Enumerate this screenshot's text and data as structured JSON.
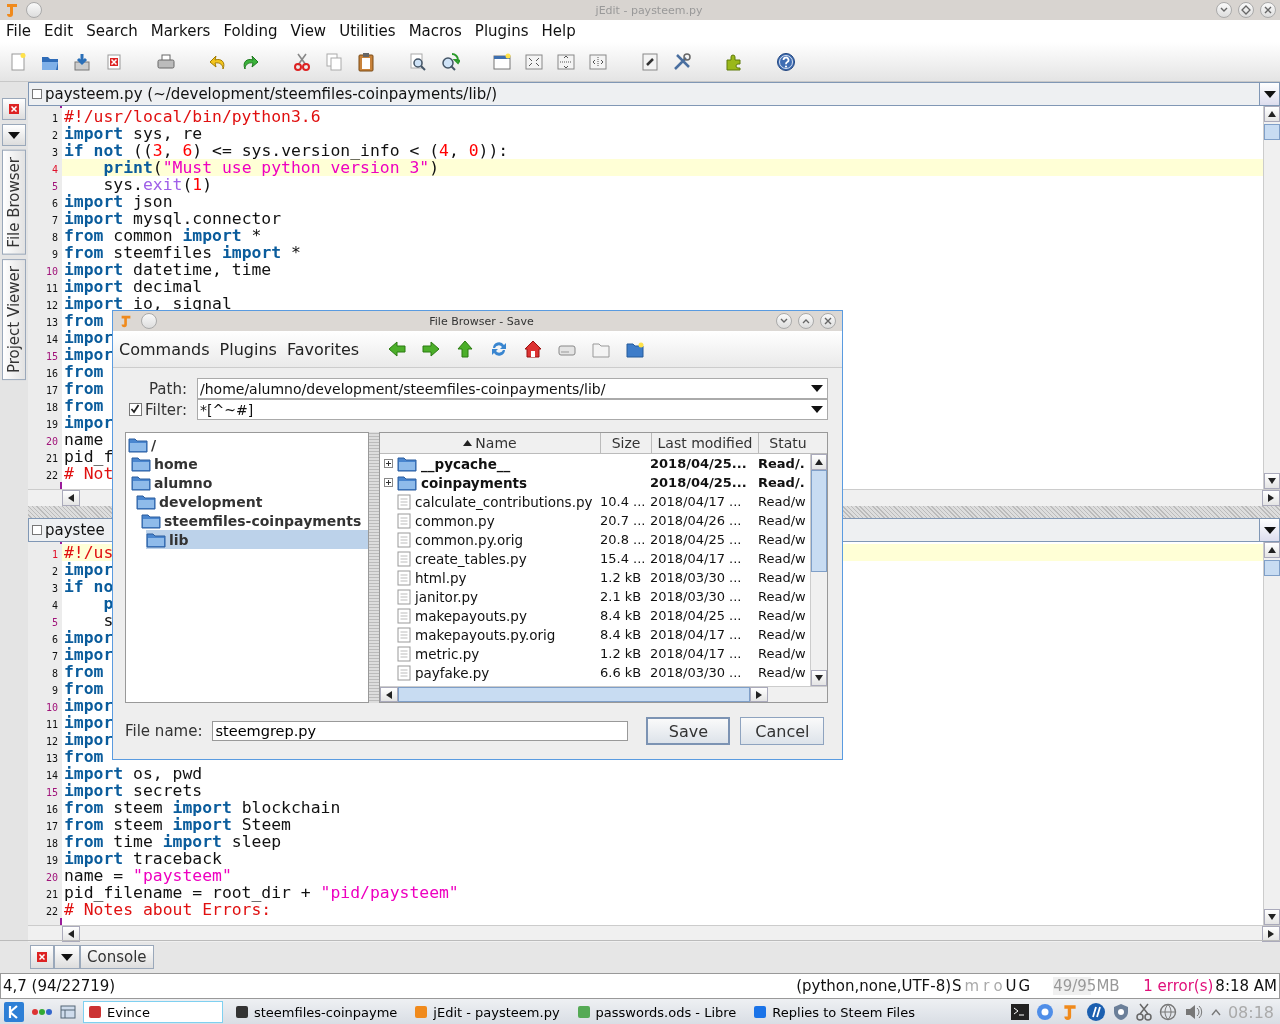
{
  "window": {
    "title": "jEdit - paysteem.py"
  },
  "menu": [
    "File",
    "Edit",
    "Search",
    "Markers",
    "Folding",
    "View",
    "Utilities",
    "Macros",
    "Plugins",
    "Help"
  ],
  "dock_tabs": [
    {
      "label": "File Browser",
      "selected": false
    },
    {
      "label": "Project Viewer",
      "selected": false
    }
  ],
  "panes": [
    {
      "title": "paysteem.py (~/development/steemfiles-coinpayments/lib/)",
      "lines": [
        {
          "number": "1",
          "current": false,
          "tokens": [
            {
              "kind": "comment",
              "text": "#!/usr/local/bin/python3.6"
            }
          ]
        },
        {
          "number": "2",
          "current": false,
          "tokens": [
            {
              "kind": "kw",
              "text": "import"
            },
            {
              "kind": "plain",
              "text": " sys, re"
            }
          ]
        },
        {
          "number": "3",
          "current": false,
          "tokens": [
            {
              "kind": "kw",
              "text": "if "
            },
            {
              "kind": "kw",
              "text": "not"
            },
            {
              "kind": "plain",
              "text": " (("
            },
            {
              "kind": "num",
              "text": "3"
            },
            {
              "kind": "plain",
              "text": ", "
            },
            {
              "kind": "num",
              "text": "6"
            },
            {
              "kind": "plain",
              "text": ") <= sys.version_info < ("
            },
            {
              "kind": "num",
              "text": "4"
            },
            {
              "kind": "plain",
              "text": ", "
            },
            {
              "kind": "num",
              "text": "0"
            },
            {
              "kind": "plain",
              "text": ")):"
            }
          ]
        },
        {
          "number": "4",
          "current": true,
          "tokens": [
            {
              "kind": "kw",
              "text": "    print"
            },
            {
              "kind": "plain",
              "text": "("
            },
            {
              "kind": "str",
              "text": "\"Must use python version 3\""
            },
            {
              "kind": "plain",
              "text": ")"
            }
          ]
        },
        {
          "number": "5",
          "current": false,
          "tokens": [
            {
              "kind": "plain",
              "text": "    sys."
            },
            {
              "kind": "fn",
              "text": "exit"
            },
            {
              "kind": "plain",
              "text": "("
            },
            {
              "kind": "num",
              "text": "1"
            },
            {
              "kind": "plain",
              "text": ")"
            }
          ]
        },
        {
          "number": "6",
          "current": false,
          "tokens": [
            {
              "kind": "kw",
              "text": "import"
            },
            {
              "kind": "plain",
              "text": " json"
            }
          ]
        },
        {
          "number": "7",
          "current": false,
          "tokens": [
            {
              "kind": "kw",
              "text": "import"
            },
            {
              "kind": "plain",
              "text": " mysql.connector"
            }
          ]
        },
        {
          "number": "8",
          "current": false,
          "tokens": [
            {
              "kind": "kw",
              "text": "from"
            },
            {
              "kind": "plain",
              "text": " common "
            },
            {
              "kind": "kw",
              "text": "import"
            },
            {
              "kind": "plain",
              "text": " *"
            }
          ]
        },
        {
          "number": "9",
          "current": false,
          "tokens": [
            {
              "kind": "kw",
              "text": "from"
            },
            {
              "kind": "plain",
              "text": " steemfiles "
            },
            {
              "kind": "kw",
              "text": "import"
            },
            {
              "kind": "plain",
              "text": " *"
            }
          ]
        },
        {
          "number": "10",
          "current": false,
          "tokens": [
            {
              "kind": "kw",
              "text": "import"
            },
            {
              "kind": "plain",
              "text": " datetime, time"
            }
          ]
        },
        {
          "number": "11",
          "current": false,
          "tokens": [
            {
              "kind": "kw",
              "text": "import"
            },
            {
              "kind": "plain",
              "text": " decimal"
            }
          ]
        },
        {
          "number": "12",
          "current": false,
          "tokens": [
            {
              "kind": "kw",
              "text": "import"
            },
            {
              "kind": "plain",
              "text": " io, signal"
            }
          ]
        },
        {
          "number": "13",
          "current": false,
          "tokens": [
            {
              "kind": "kw",
              "text": "from"
            }
          ]
        },
        {
          "number": "14",
          "current": false,
          "tokens": [
            {
              "kind": "kw",
              "text": "impor"
            }
          ]
        },
        {
          "number": "15",
          "current": false,
          "tokens": [
            {
              "kind": "kw",
              "text": "impor"
            }
          ]
        },
        {
          "number": "16",
          "current": false,
          "tokens": [
            {
              "kind": "kw",
              "text": "from"
            }
          ]
        },
        {
          "number": "17",
          "current": false,
          "tokens": [
            {
              "kind": "kw",
              "text": "from"
            }
          ]
        },
        {
          "number": "18",
          "current": false,
          "tokens": [
            {
              "kind": "kw",
              "text": "from"
            }
          ]
        },
        {
          "number": "19",
          "current": false,
          "tokens": [
            {
              "kind": "kw",
              "text": "impor"
            }
          ]
        },
        {
          "number": "20",
          "current": false,
          "tokens": [
            {
              "kind": "plain",
              "text": "name"
            }
          ]
        },
        {
          "number": "21",
          "current": false,
          "tokens": [
            {
              "kind": "plain",
              "text": "pid_f"
            }
          ]
        },
        {
          "number": "22",
          "current": false,
          "tokens": [
            {
              "kind": "comment",
              "text": "# Not"
            }
          ]
        }
      ]
    },
    {
      "title": "paystee",
      "lines": [
        {
          "number": "1",
          "current": true,
          "tokens": [
            {
              "kind": "comment",
              "text": "#!/us"
            }
          ]
        },
        {
          "number": "2",
          "current": false,
          "tokens": [
            {
              "kind": "kw",
              "text": "impor"
            }
          ]
        },
        {
          "number": "3",
          "current": false,
          "tokens": [
            {
              "kind": "kw",
              "text": "if no"
            }
          ]
        },
        {
          "number": "4",
          "current": false,
          "tokens": [
            {
              "kind": "kw",
              "text": "    p"
            }
          ]
        },
        {
          "number": "5",
          "current": false,
          "tokens": [
            {
              "kind": "plain",
              "text": "    s"
            }
          ]
        },
        {
          "number": "6",
          "current": false,
          "tokens": [
            {
              "kind": "kw",
              "text": "impor"
            }
          ]
        },
        {
          "number": "7",
          "current": false,
          "tokens": [
            {
              "kind": "kw",
              "text": "impor"
            }
          ]
        },
        {
          "number": "8",
          "current": false,
          "tokens": [
            {
              "kind": "kw",
              "text": "from"
            }
          ]
        },
        {
          "number": "9",
          "current": false,
          "tokens": [
            {
              "kind": "kw",
              "text": "from"
            }
          ]
        },
        {
          "number": "10",
          "current": false,
          "tokens": [
            {
              "kind": "kw",
              "text": "impor"
            }
          ]
        },
        {
          "number": "11",
          "current": false,
          "tokens": [
            {
              "kind": "kw",
              "text": "impor"
            }
          ]
        },
        {
          "number": "12",
          "current": false,
          "tokens": [
            {
              "kind": "kw",
              "text": "impor"
            }
          ]
        },
        {
          "number": "13",
          "current": false,
          "tokens": [
            {
              "kind": "kw",
              "text": "from"
            }
          ]
        },
        {
          "number": "14",
          "current": false,
          "tokens": [
            {
              "kind": "kw",
              "text": "import"
            },
            {
              "kind": "plain",
              "text": " os, pwd"
            }
          ]
        },
        {
          "number": "15",
          "current": false,
          "tokens": [
            {
              "kind": "kw",
              "text": "import"
            },
            {
              "kind": "plain",
              "text": " secrets"
            }
          ]
        },
        {
          "number": "16",
          "current": false,
          "tokens": [
            {
              "kind": "kw",
              "text": "from"
            },
            {
              "kind": "plain",
              "text": " steem "
            },
            {
              "kind": "kw",
              "text": "import"
            },
            {
              "kind": "plain",
              "text": " blockchain"
            }
          ]
        },
        {
          "number": "17",
          "current": false,
          "tokens": [
            {
              "kind": "kw",
              "text": "from"
            },
            {
              "kind": "plain",
              "text": " steem "
            },
            {
              "kind": "kw",
              "text": "import"
            },
            {
              "kind": "plain",
              "text": " Steem"
            }
          ]
        },
        {
          "number": "18",
          "current": false,
          "tokens": [
            {
              "kind": "kw",
              "text": "from"
            },
            {
              "kind": "plain",
              "text": " time "
            },
            {
              "kind": "kw",
              "text": "import"
            },
            {
              "kind": "plain",
              "text": " sleep"
            }
          ]
        },
        {
          "number": "19",
          "current": false,
          "tokens": [
            {
              "kind": "kw",
              "text": "import"
            },
            {
              "kind": "plain",
              "text": " traceback"
            }
          ]
        },
        {
          "number": "20",
          "current": false,
          "tokens": [
            {
              "kind": "plain",
              "text": "name = "
            },
            {
              "kind": "str",
              "text": "\"paysteem\""
            }
          ]
        },
        {
          "number": "21",
          "current": false,
          "tokens": [
            {
              "kind": "plain",
              "text": "pid_filename = root_dir + "
            },
            {
              "kind": "str",
              "text": "\"pid/paysteem\""
            }
          ]
        },
        {
          "number": "22",
          "current": false,
          "tokens": [
            {
              "kind": "comment",
              "text": "# Notes about Errors:"
            }
          ]
        }
      ]
    }
  ],
  "file_browser": {
    "title": "File Browser - Save",
    "menu": [
      "Commands",
      "Plugins",
      "Favorites"
    ],
    "path_label": "Path:",
    "path": "/home/alumno/development/steemfiles-coinpayments/lib/",
    "filter": {
      "label": "Filter:",
      "checked": true,
      "value": "*[^~#]"
    },
    "tree": [
      {
        "label": "/",
        "selected": false,
        "children": [
          {
            "label": "home",
            "selected": false,
            "children": [
              {
                "label": "alumno",
                "selected": false,
                "children": [
                  {
                    "label": "development",
                    "selected": false,
                    "children": [
                      {
                        "label": "steemfiles-coinpayments",
                        "selected": false,
                        "children": [
                          {
                            "label": "lib",
                            "selected": true
                          }
                        ]
                      }
                    ]
                  }
                ]
              }
            ]
          }
        ]
      }
    ],
    "columns": [
      {
        "label": "Name",
        "sorted": true
      },
      {
        "label": "Size",
        "sorted": false
      },
      {
        "label": "Last modified",
        "sorted": false
      },
      {
        "label": "Statu",
        "sorted": false
      }
    ],
    "rows": [
      {
        "kind": "folder",
        "name": "__pycache__",
        "modified": "2018/04/25...",
        "status": "Read/."
      },
      {
        "kind": "folder",
        "name": "coinpayments",
        "modified": "2018/04/25...",
        "status": "Read/."
      },
      {
        "kind": "file",
        "name": "calculate_contributions.py",
        "size": "10.4 ...",
        "modified": "2018/04/17 ...",
        "status": "Read/w"
      },
      {
        "kind": "file",
        "name": "common.py",
        "size": "20.7 ...",
        "modified": "2018/04/26 ...",
        "status": "Read/w"
      },
      {
        "kind": "file",
        "name": "common.py.orig",
        "size": "20.8 ...",
        "modified": "2018/04/25 ...",
        "status": "Read/w"
      },
      {
        "kind": "file",
        "name": "create_tables.py",
        "size": "15.4 ...",
        "modified": "2018/04/17 ...",
        "status": "Read/w"
      },
      {
        "kind": "file",
        "name": "html.py",
        "size": "1.2 kB",
        "modified": "2018/03/30 ...",
        "status": "Read/w"
      },
      {
        "kind": "file",
        "name": "janitor.py",
        "size": "2.1 kB",
        "modified": "2018/03/30 ...",
        "status": "Read/w"
      },
      {
        "kind": "file",
        "name": "makepayouts.py",
        "size": "8.4 kB",
        "modified": "2018/04/25 ...",
        "status": "Read/w"
      },
      {
        "kind": "file",
        "name": "makepayouts.py.orig",
        "size": "8.4 kB",
        "modified": "2018/04/17 ...",
        "status": "Read/w"
      },
      {
        "kind": "file",
        "name": "metric.py",
        "size": "1.2 kB",
        "modified": "2018/04/17 ...",
        "status": "Read/w"
      },
      {
        "kind": "file",
        "name": "payfake.py",
        "size": "6.6 kB",
        "modified": "2018/03/30 ...",
        "status": "Read/w"
      }
    ],
    "file_name_label": "File name:",
    "file_name": "steemgrep.py",
    "buttons": [
      "Save",
      "Cancel"
    ]
  },
  "console": {
    "label": "Console"
  },
  "status_bar": {
    "position": "4,7 (94/22719)",
    "mode": "(python,none,UTF-8)",
    "flags": [
      {
        "text": "S",
        "on": true
      },
      {
        "text": "m",
        "on": false
      },
      {
        "text": "r",
        "on": false
      },
      {
        "text": "o",
        "on": false
      },
      {
        "text": "U",
        "on": true
      },
      {
        "text": "G",
        "on": true
      }
    ],
    "memory": {
      "text": "49/95MB",
      "level": 0.52
    },
    "errors": "1 error(s)",
    "time": "8:18 AM"
  },
  "taskbar": {
    "tasks": [
      {
        "label": "Evince",
        "selected": true
      },
      {
        "label": "steemfiles-coinpayme",
        "selected": false
      },
      {
        "label": "jEdit - paysteem.py",
        "selected": false
      },
      {
        "label": "passwords.ods - Libre",
        "selected": false
      },
      {
        "label": "Replies to Steem Files",
        "selected": false
      }
    ],
    "clock": "08:18"
  }
}
